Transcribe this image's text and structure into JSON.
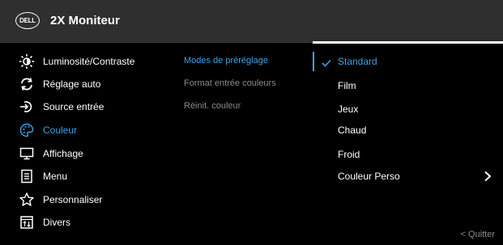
{
  "header": {
    "logo_text": "DELL",
    "title": "2X Moniteur"
  },
  "menu": {
    "items": [
      {
        "label": "Luminosité/Contraste",
        "icon": "brightness-icon"
      },
      {
        "label": "Réglage auto",
        "icon": "auto-adjust-icon"
      },
      {
        "label": "Source entrée",
        "icon": "input-source-icon"
      },
      {
        "label": "Couleur",
        "icon": "palette-icon",
        "active": true
      },
      {
        "label": "Affichage",
        "icon": "display-icon"
      },
      {
        "label": "Menu",
        "icon": "menu-doc-icon"
      },
      {
        "label": "Personnaliser",
        "icon": "star-icon"
      },
      {
        "label": "Divers",
        "icon": "misc-icon"
      }
    ]
  },
  "submenu": {
    "items": [
      {
        "label": "Modes de préréglage",
        "active": true
      },
      {
        "label": "Format entrée couleurs"
      },
      {
        "label": "Réinit. couleur"
      }
    ]
  },
  "options": {
    "items": [
      {
        "label": "Standard",
        "selected": true
      },
      {
        "label": "Film"
      },
      {
        "label": "Jeux"
      },
      {
        "label": "Chaud"
      },
      {
        "label": "Froid"
      },
      {
        "label": "Couleur Perso"
      }
    ]
  },
  "footer": {
    "quit_label": "< Quitter"
  },
  "colors": {
    "accent": "#3ea3e6",
    "header_bg": "#2f2f2f",
    "background": "#000000",
    "inactive_text": "#8a8a8a"
  }
}
